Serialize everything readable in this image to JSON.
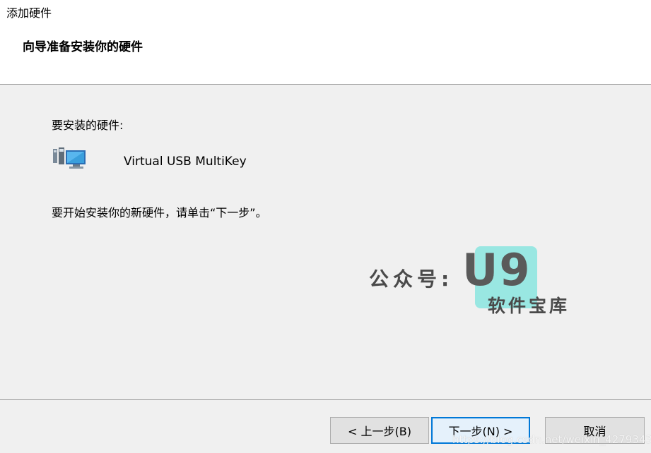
{
  "window": {
    "title": "添加硬件",
    "heading": "向导准备安装你的硬件"
  },
  "content": {
    "hardware_label": "要安装的硬件:",
    "device_name": "Virtual USB MultiKey",
    "device_icon": "computer-devices-icon",
    "instruction": "要开始安装你的新硬件，请单击“下一步”。"
  },
  "watermark": {
    "prefix": "公众号:",
    "logo": "U9",
    "subtitle": "软件宝库",
    "badge_color": "#8fe6e0",
    "url": "https://blog.csdn.net/weixin_42793435"
  },
  "buttons": {
    "back": "< 上一步(B)",
    "next": "下一步(N) >",
    "cancel": "取消"
  },
  "colors": {
    "header_bg": "#ffffff",
    "body_bg": "#f0f0f0",
    "default_button_border": "#0078d7"
  }
}
